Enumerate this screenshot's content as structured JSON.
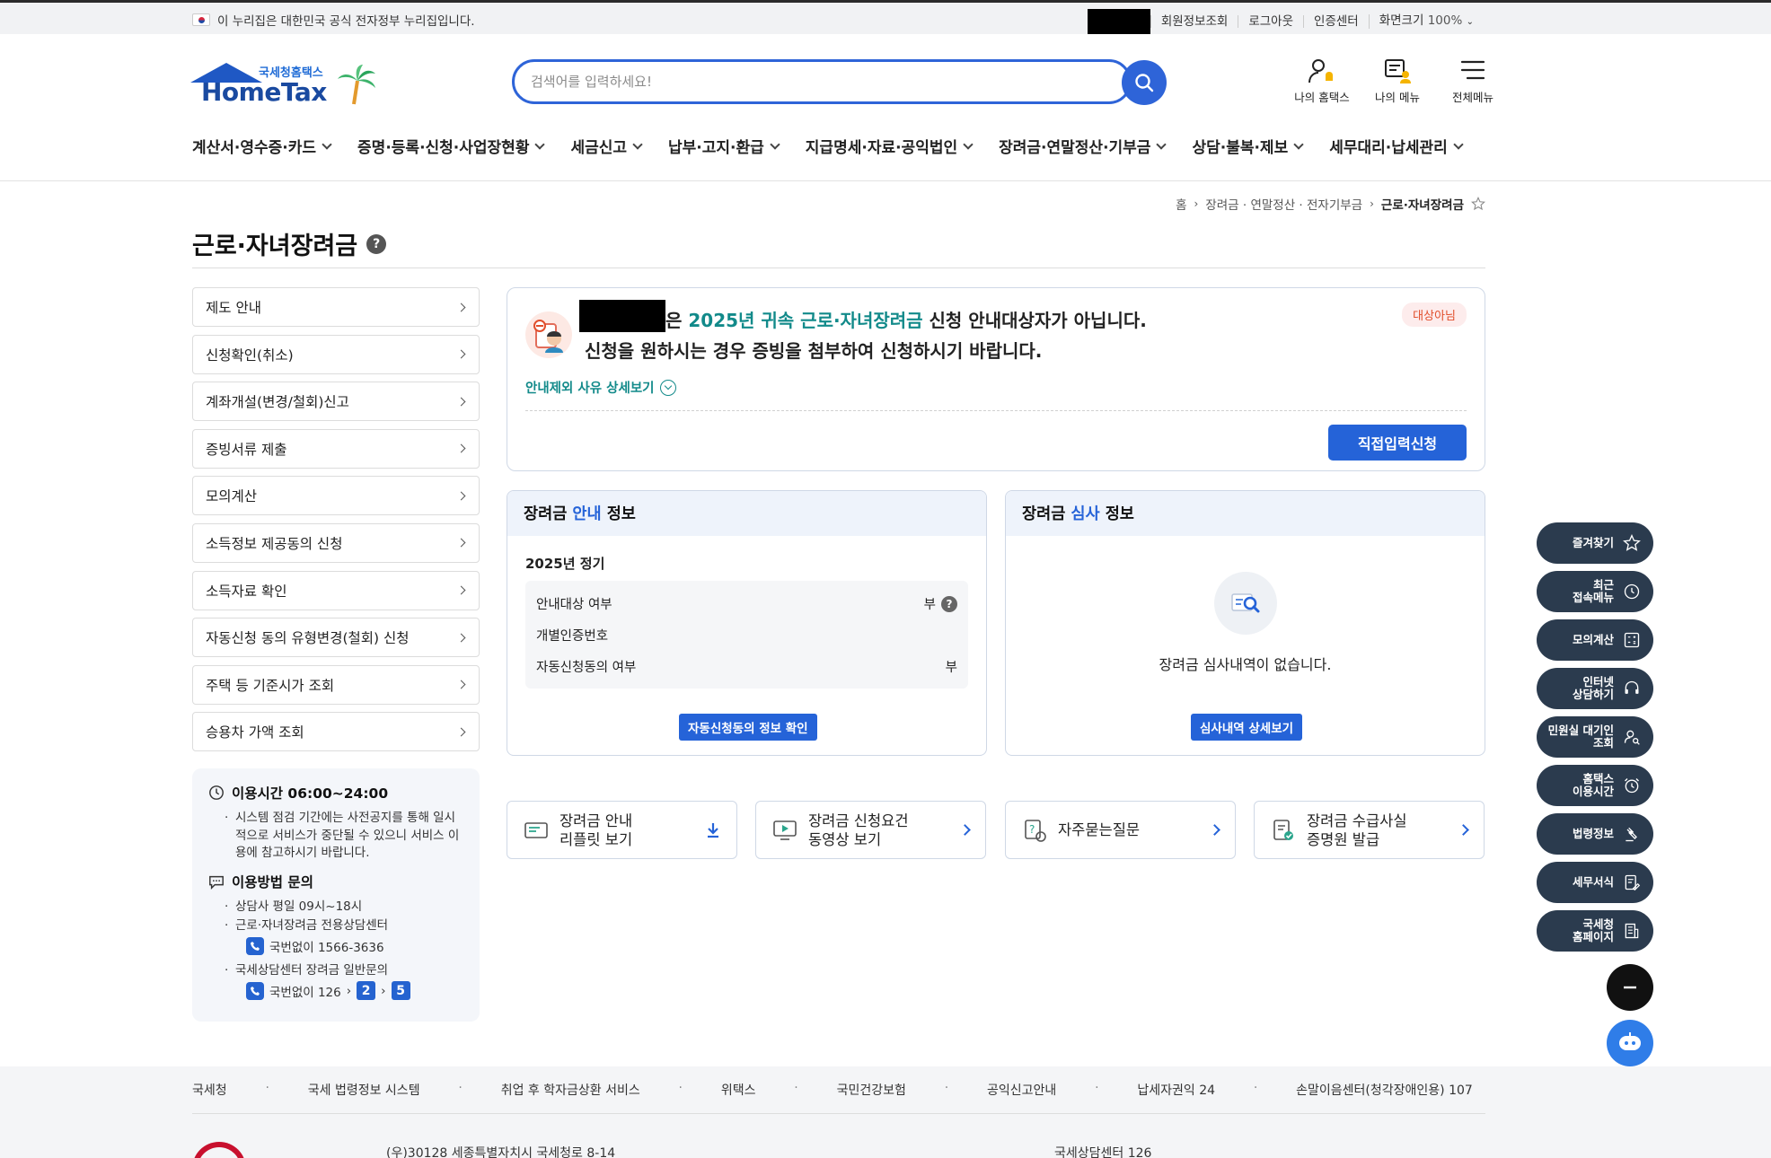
{
  "gov_bar": {
    "notice": "이 누리집은 대한민국 공식 전자정부 누리집입니다.",
    "links": [
      "회원정보조회",
      "로그아웃",
      "인증센터"
    ],
    "zoom_label": "화면크기",
    "zoom_value": "100%"
  },
  "header": {
    "logo_sub": "국세청홈택스",
    "logo_main": "HomeTax",
    "search_placeholder": "검색어를 입력하세요!",
    "menus": [
      "나의 홈택스",
      "나의 메뉴",
      "전체메뉴"
    ]
  },
  "gnb": [
    "계산서·영수증·카드",
    "증명·등록·신청·사업장현황",
    "세금신고",
    "납부·고지·환급",
    "지급명세·자료·공익법인",
    "장려금·연말정산·기부금",
    "상담·불복·제보",
    "세무대리·납세관리"
  ],
  "breadcrumb": [
    "홈",
    "장려금 · 연말정산 · 전자기부금",
    "근로·자녀장려금"
  ],
  "page_title": "근로·자녀장려금",
  "lnb": [
    "제도 안내",
    "신청확인(취소)",
    "계좌개설(변경/철회)신고",
    "증빙서류 제출",
    "모의계산",
    "소득정보 제공동의 신청",
    "소득자료 확인",
    "자동신청 동의 유형변경(철회) 신청",
    "주택 등 기준시가 조회",
    "승용차 가액 조회"
  ],
  "info_box": {
    "hours_title": "이용시간 06:00~24:00",
    "hours_note": "시스템 점검 기간에는 사전공지를 통해 일시적으로 서비스가 중단될 수 있으니 서비스 이용에 참고하시기 바랍니다.",
    "inquiry_title": "이용방법 문의",
    "inquiry_hours": "상담사 평일 09시~18시",
    "center1": "근로·자녀장려금 전용상담센터",
    "tel1": "국번없이 1566-3636",
    "center2": "국세상담센터 장려금 일반문의",
    "tel2_prefix": "국번없이 126",
    "tel2_step1": "2",
    "tel2_step2": "5"
  },
  "notice": {
    "line1_particle": "은",
    "line1_highlight": "2025년 귀속 근로·자녀장려금",
    "line1_rest": "신청 안내대상자가 아닙니다.",
    "line2": "신청을 원하시는 경우 증빙을 첨부하여 신청하시기 바랍니다.",
    "status_badge": "대상아님",
    "detail_link": "안내제외 사유 상세보기",
    "apply_button": "직접입력신청"
  },
  "guide_panel": {
    "title_pre": "장려금",
    "title_hl": "안내",
    "title_post": "정보",
    "period": "2025년 정기",
    "rows": [
      {
        "label": "안내대상 여부",
        "value": "부"
      },
      {
        "label": "개별인증번호",
        "value": ""
      },
      {
        "label": "자동신청동의 여부",
        "value": "부"
      }
    ],
    "button": "자동신청동의 정보 확인"
  },
  "review_panel": {
    "title_pre": "장려금",
    "title_hl": "심사",
    "title_post": "정보",
    "empty_text": "장려금 심사내역이 없습니다.",
    "button": "심사내역 상세보기"
  },
  "quick_cards": [
    {
      "line1": "장려금 안내",
      "line2": "리플릿 보기"
    },
    {
      "line1": "장려금 신청요건",
      "line2": "동영상 보기"
    },
    {
      "line1": "자주묻는질문",
      "line2": ""
    },
    {
      "line1": "장려금 수급사실",
      "line2": "증명원 발급"
    }
  ],
  "quick_menu": [
    {
      "l1": "즐겨찾기",
      "l2": ""
    },
    {
      "l1": "최근",
      "l2": "접속메뉴"
    },
    {
      "l1": "모의계산",
      "l2": ""
    },
    {
      "l1": "인터넷",
      "l2": "상담하기"
    },
    {
      "l1": "민원실 대기인",
      "l2": "조회"
    },
    {
      "l1": "홈택스",
      "l2": "이용시간"
    },
    {
      "l1": "법령정보",
      "l2": ""
    },
    {
      "l1": "세무서식",
      "l2": ""
    },
    {
      "l1": "국세청",
      "l2": "홈페이지"
    }
  ],
  "footer": {
    "links": [
      "국세청",
      "국세 법령정보 시스템",
      "취업 후 학자금상환 서비스",
      "위택스",
      "국민건강보험",
      "공익신고안내",
      "납세자권익 24",
      "손말이음센터(청각장애인용) 107"
    ],
    "address": "(우)30128 세종특별자치시 국세청로 8-14",
    "center": "국세상담센터 126"
  },
  "colors": {
    "primary": "#2563d8",
    "teal": "#128a8a",
    "quick_bg": "#2b3b4e",
    "badge_red": "#e14e2b"
  }
}
